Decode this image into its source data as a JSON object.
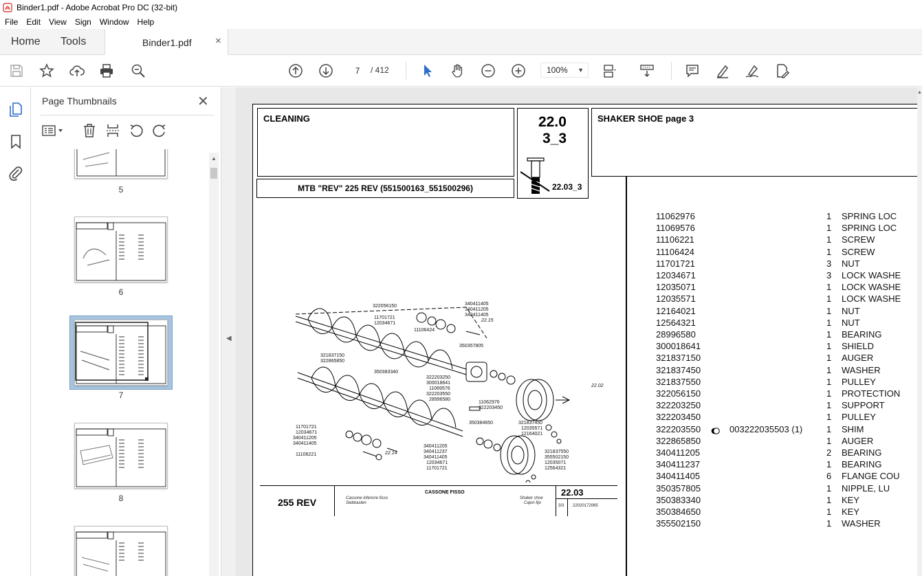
{
  "window": {
    "title": "Binder1.pdf - Adobe Acrobat Pro DC (32-bit)"
  },
  "menu": [
    "File",
    "Edit",
    "View",
    "Sign",
    "Window",
    "Help"
  ],
  "tabs": {
    "home": "Home",
    "tools": "Tools",
    "document": "Binder1.pdf",
    "close_glyph": "×"
  },
  "toolbar": {
    "page_current": "7",
    "page_total": "/ 412",
    "zoom": "100%"
  },
  "panel": {
    "title": "Page Thumbnails",
    "close_glyph": "✕",
    "thumbnails": [
      {
        "label": "5"
      },
      {
        "label": "6"
      },
      {
        "label": "7",
        "selected": true
      },
      {
        "label": "8"
      }
    ]
  },
  "page": {
    "section": "CLEANING",
    "code_line1": "22.0",
    "code_line2": "3_3",
    "code_small": "22.03_3",
    "title": "SHAKER SHOE  page 3",
    "model": "MTB \"REV\" 225 REV (551500163_551500296)",
    "drawing": {
      "model": "255 REV",
      "title_it": "CASSONE FISSO",
      "sub_it": "Cassone inferiore fisso",
      "sub_de": "Siebkasten",
      "shoe_en": "Shaker shoe",
      "shoe_es": "Cajon fijo",
      "code": "22.03",
      "sheet": "3/3",
      "date": "22020172065",
      "callouts": [
        "322056150",
        "340411405",
        "340411205",
        "340411405",
        "11701721",
        "12034671",
        "22.15",
        "11106424",
        "350357805",
        "321837150",
        "322865850",
        "350383340",
        "322203250",
        "300018641",
        "11069576",
        "322203550",
        "28996580",
        "22.02",
        "11062976",
        "322203450",
        "350384650",
        "321837450",
        "12035571",
        "12164021",
        "11701721",
        "12034671",
        "340411205",
        "340411405",
        "11106221",
        "22.14",
        "340411205",
        "340411237",
        "340411405",
        "12034671",
        "11701721",
        "321837550",
        "355502150",
        "12035071",
        "12564321"
      ]
    },
    "parts": [
      {
        "pn": "11062976",
        "qty": "1",
        "desc": "SPRING LOC"
      },
      {
        "pn": "11069576",
        "qty": "1",
        "desc": "SPRING LOC"
      },
      {
        "pn": "11106221",
        "qty": "1",
        "desc": "SCREW"
      },
      {
        "pn": "11106424",
        "qty": "1",
        "desc": "SCREW"
      },
      {
        "pn": "11701721",
        "qty": "3",
        "desc": "NUT"
      },
      {
        "pn": "12034671",
        "qty": "3",
        "desc": "LOCK WASHE"
      },
      {
        "pn": "12035071",
        "qty": "1",
        "desc": "LOCK WASHE"
      },
      {
        "pn": "12035571",
        "qty": "1",
        "desc": "LOCK WASHE"
      },
      {
        "pn": "12164021",
        "qty": "1",
        "desc": "NUT"
      },
      {
        "pn": "12564321",
        "qty": "1",
        "desc": "NUT"
      },
      {
        "pn": "28996580",
        "qty": "1",
        "desc": "BEARING"
      },
      {
        "pn": "300018641",
        "qty": "1",
        "desc": "SHIELD"
      },
      {
        "pn": "321837150",
        "qty": "1",
        "desc": "AUGER"
      },
      {
        "pn": "321837450",
        "qty": "1",
        "desc": "WASHER"
      },
      {
        "pn": "321837550",
        "qty": "1",
        "desc": "PULLEY"
      },
      {
        "pn": "322056150",
        "qty": "1",
        "desc": "PROTECTION"
      },
      {
        "pn": "322203250",
        "qty": "1",
        "desc": "SUPPORT"
      },
      {
        "pn": "322203450",
        "qty": "1",
        "desc": "PULLEY"
      },
      {
        "pn": "322203550",
        "qty": "1",
        "desc": "SHIM",
        "note": "003222035503  (1)"
      },
      {
        "pn": "322865850",
        "qty": "1",
        "desc": "AUGER"
      },
      {
        "pn": "340411205",
        "qty": "2",
        "desc": "BEARING"
      },
      {
        "pn": "340411237",
        "qty": "1",
        "desc": "BEARING"
      },
      {
        "pn": "340411405",
        "qty": "6",
        "desc": "FLANGE COU"
      },
      {
        "pn": "350357805",
        "qty": "1",
        "desc": "NIPPLE, LU"
      },
      {
        "pn": "350383340",
        "qty": "1",
        "desc": "KEY"
      },
      {
        "pn": "350384650",
        "qty": "1",
        "desc": "KEY"
      },
      {
        "pn": "355502150",
        "qty": "1",
        "desc": "WASHER"
      }
    ]
  },
  "colors": {
    "accent": "#2c6ecb",
    "selection": "#a8c4de",
    "pdf_red": "#d9261c"
  }
}
